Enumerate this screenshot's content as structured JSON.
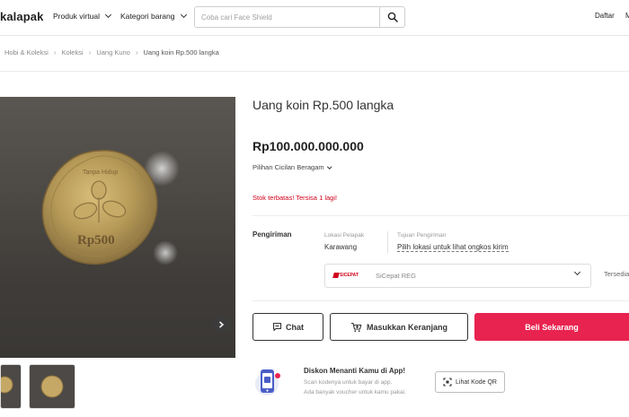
{
  "header": {
    "logo_text": "kalapak",
    "nav": [
      "Produk virtual",
      "Kategori barang"
    ],
    "search_placeholder": "Coba cari Face Shield",
    "daftar_label": "Daftar",
    "cut_label": "M"
  },
  "breadcrumb": [
    "Hobi & Koleksi",
    "Koleksi",
    "Uang Kuno",
    "Uang koin Rp.500 langka"
  ],
  "product": {
    "title": "Uang koin Rp.500 langka",
    "price": "Rp100.000.000.000",
    "cicilan": "Pilihan Cicilan Beragam",
    "stock_warning": "Stok terbatas! Tersisa 1 lagi!",
    "coin_inscription_top": "Tanpa Hidup",
    "coin_inscription_value": "Rp500"
  },
  "shipping": {
    "label": "Pengiriman",
    "lokasi_header": "Lokasi Pelapak",
    "lokasi_value": "Karawang",
    "tujuan_header": "Tujuan Pengiriman",
    "tujuan_link": "Pilih lokasi untuk lihat ongkos kirim",
    "courier_logo": "SICEPAT",
    "courier_name": "SiCepat REG",
    "availability": "Tersedia"
  },
  "actions": {
    "chat": "Chat",
    "cart": "Masukkan Keranjang",
    "buy": "Beli Sekarang"
  },
  "promo": {
    "title": "Diskon Menanti Kamu di App!",
    "line1": "Scan kodenya untuk bayar di app.",
    "line2": "Ada banyak voucher untuk kamu pakai.",
    "qr_button": "Lihat Kode QR"
  },
  "colors": {
    "brand_red": "#e8234f",
    "stock_red": "#d0021b"
  }
}
